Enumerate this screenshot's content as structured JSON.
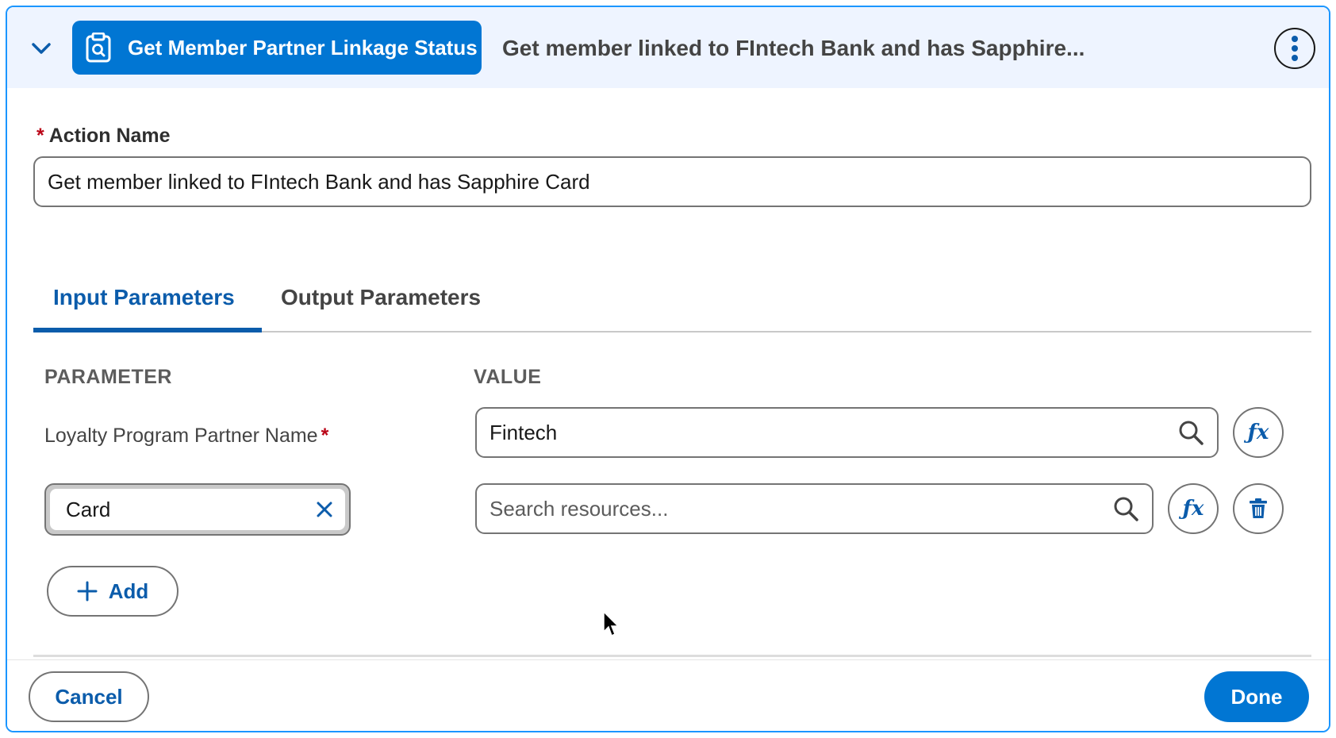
{
  "header": {
    "action_type_label": "Get Member Partner Linkage Status",
    "action_icon": "clipboard-search-icon",
    "title": "Get member linked to FIntech Bank and has Sapphire..."
  },
  "action_name": {
    "required_marker": "*",
    "label": "Action Name",
    "value": "Get member linked to FIntech Bank and has Sapphire Card"
  },
  "tabs": [
    {
      "label": "Input Parameters",
      "active": true
    },
    {
      "label": "Output Parameters",
      "active": false
    }
  ],
  "table": {
    "headers": {
      "parameter": "PARAMETER",
      "value": "VALUE"
    },
    "rows": [
      {
        "parameter": "Loyalty Program Partner Name",
        "required_marker": "*",
        "value": "Fintech"
      },
      {
        "parameter": "Card",
        "value_placeholder": "Search resources..."
      }
    ]
  },
  "add_button": {
    "label": "Add"
  },
  "footer": {
    "cancel_label": "Cancel",
    "done_label": "Done"
  },
  "colors": {
    "brand_blue": "#0176d3",
    "link_blue": "#0b5cab",
    "required_red": "#ba0517",
    "header_bg": "#eef4ff"
  }
}
